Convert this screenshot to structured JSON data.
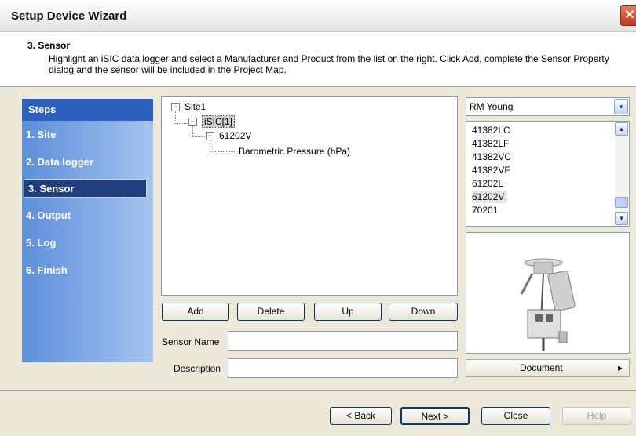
{
  "window": {
    "title": "Setup Device Wizard",
    "close_glyph": "✕"
  },
  "header": {
    "title": "3. Sensor",
    "description": "Highlight an iSIC data logger and select a Manufacturer and Product from the list on the right. Click Add, complete the Sensor Property dialog and the sensor will be included in the Project Map."
  },
  "steps": {
    "heading": "Steps",
    "items": [
      {
        "label": "1. Site"
      },
      {
        "label": "2. Data logger"
      },
      {
        "label": "3. Sensor"
      },
      {
        "label": "4. Output"
      },
      {
        "label": "5. Log"
      },
      {
        "label": "6. Finish"
      }
    ],
    "active_index": 2
  },
  "tree": {
    "site": "Site1",
    "logger": "iSIC[1]",
    "sensor": "61202V",
    "measurement": "Barometric Pressure (hPa)",
    "expand_glyph": "−"
  },
  "actions": {
    "add": "Add",
    "delete": "Delete",
    "up": "Up",
    "down": "Down"
  },
  "form": {
    "sensor_name_label": "Sensor Name",
    "sensor_name_value": "",
    "description_label": "Description",
    "description_value": ""
  },
  "manufacturer": {
    "selected": "RM Young",
    "arrow": "▾"
  },
  "products": {
    "items": [
      "41382LC",
      "41382LF",
      "41382VC",
      "41382VF",
      "61202L",
      "61202V",
      "70201"
    ],
    "selected": "61202V",
    "scroll_up": "▲",
    "scroll_down": "▼"
  },
  "document_button": {
    "label": "Document",
    "arrow": "▸"
  },
  "nav": {
    "back": "< Back",
    "next": "Next >",
    "close": "Close",
    "help": "Help"
  },
  "colors": {
    "steps_heading": "#2d5fbf",
    "active_step": "#1f3f7f",
    "close_button": "#c7381b"
  }
}
